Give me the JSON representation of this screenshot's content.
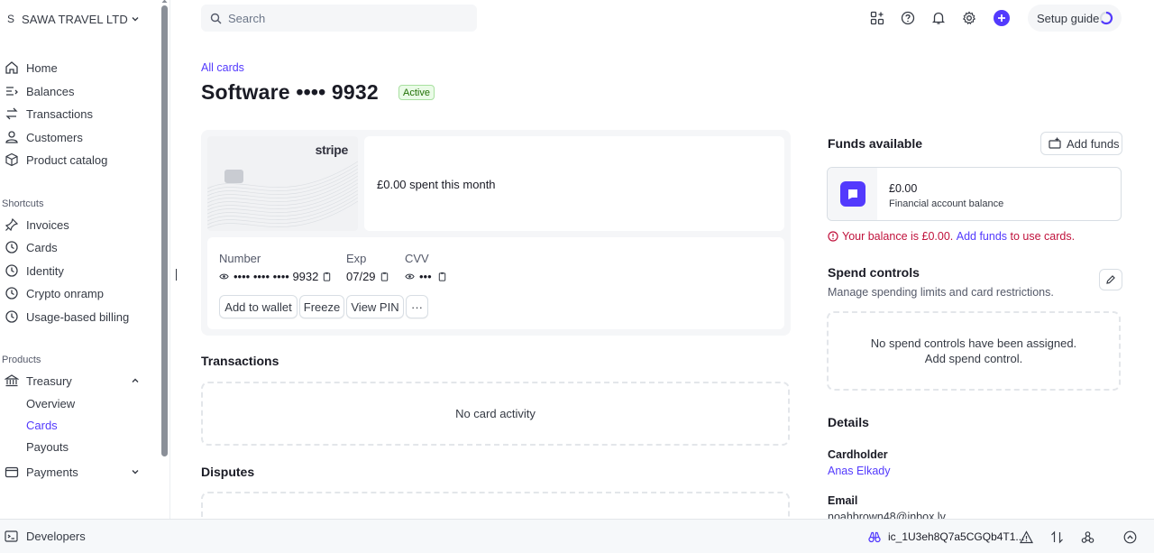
{
  "account": {
    "initial": "S",
    "name": "SAWA TRAVEL LTD"
  },
  "nav": {
    "home": "Home",
    "balances": "Balances",
    "transactions": "Transactions",
    "customers": "Customers",
    "product_catalog": "Product catalog"
  },
  "shortcuts": {
    "label": "Shortcuts",
    "invoices": "Invoices",
    "cards": "Cards",
    "identity": "Identity",
    "crypto": "Crypto onramp",
    "usage": "Usage-based billing"
  },
  "products": {
    "label": "Products",
    "treasury": "Treasury",
    "overview": "Overview",
    "cards": "Cards",
    "payouts": "Payouts",
    "payments": "Payments"
  },
  "search": {
    "placeholder": "Search"
  },
  "setup_guide": "Setup guide",
  "breadcrumb": "All cards",
  "page_title": "Software •••• 9932",
  "status": "Active",
  "card": {
    "brand": "stripe",
    "spent": "£0.00 spent this month",
    "number_label": "Number",
    "number_value": "•••• •••• •••• 9932",
    "exp_label": "Exp",
    "exp_value": "07/29",
    "cvv_label": "CVV",
    "cvv_value": "•••",
    "add_wallet": "Add to wallet",
    "freeze": "Freeze",
    "view_pin": "View PIN",
    "more": "···"
  },
  "transactions": {
    "title": "Transactions",
    "empty": "No card activity"
  },
  "disputes": {
    "title": "Disputes"
  },
  "funds": {
    "title": "Funds available",
    "add_funds": "Add funds",
    "amount": "£0.00",
    "sub": "Financial account balance",
    "warn_prefix": "Your balance is £0.00.",
    "warn_link": "Add funds",
    "warn_suffix": "to use cards."
  },
  "spend_controls": {
    "title": "Spend controls",
    "subtitle": "Manage spending limits and card restrictions.",
    "empty": "No spend controls have been assigned. Add spend control."
  },
  "details": {
    "title": "Details",
    "cardholder_label": "Cardholder",
    "cardholder_value": "Anas Elkady",
    "email_label": "Email",
    "email_value": "noahbrown48@inbox.lv"
  },
  "footer": {
    "developers": "Developers",
    "key": "ic_1U3eh8Q7a5CGQb4T1..."
  },
  "colors": {
    "accent": "#533afd",
    "error": "#c0123c",
    "success": "#217005"
  }
}
